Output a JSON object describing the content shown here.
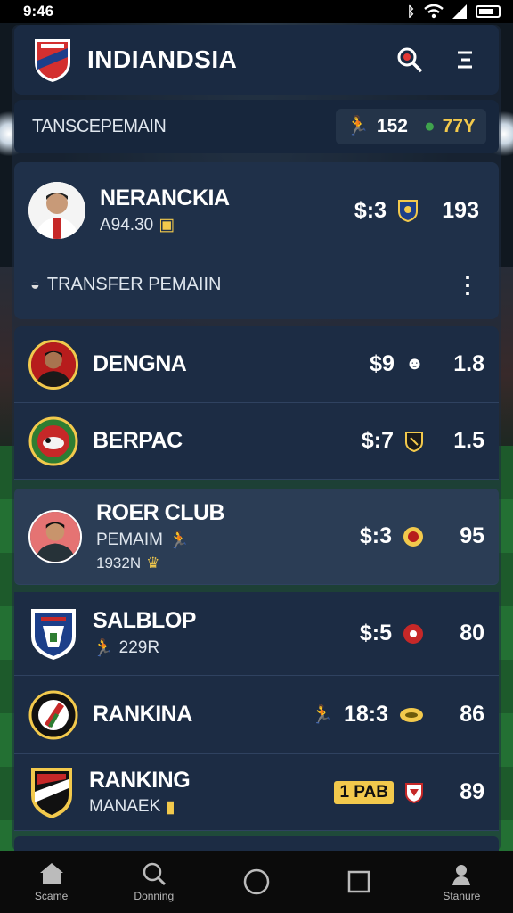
{
  "status_bar": {
    "time": "9:46"
  },
  "header": {
    "title": "INDIANDSIA"
  },
  "subbar": {
    "title": "TANSCEPEMAIN",
    "stat1": "152",
    "stat2": "77Y"
  },
  "featured": {
    "name": "NERANCKIA",
    "sub": "A94.30",
    "price": "$:3",
    "score": "193",
    "section_label": "TRANSFER PEMAIIN"
  },
  "players": [
    {
      "name": "DENGNA",
      "sub1": "",
      "sub2": "",
      "price": "$9",
      "score": "1.8"
    },
    {
      "name": "BERPAC",
      "sub1": "",
      "sub2": "",
      "price": "$:7",
      "score": "1.5"
    },
    {
      "name": "ROER CLUB",
      "sub1": "PEMAIM",
      "sub2": "1932N",
      "price": "$:3",
      "score": "95"
    },
    {
      "name": "SALBLOP",
      "sub1": "229R",
      "sub2": "",
      "price": "$:5",
      "score": "80"
    },
    {
      "name": "RANKINA",
      "sub1": "",
      "sub2": "",
      "price": "18:3",
      "score": "86"
    },
    {
      "name": "RANKING",
      "sub1": "MANAEK",
      "sub2": "",
      "price": "1 PAB",
      "score": "89"
    }
  ],
  "bottom_nav": [
    {
      "label": "Scame",
      "icon": "home-icon"
    },
    {
      "label": "Donning",
      "icon": "search-icon"
    },
    {
      "label": "",
      "icon": "circle-icon"
    },
    {
      "label": "",
      "icon": "square-icon"
    },
    {
      "label": "Stanure",
      "icon": "profile-icon"
    }
  ],
  "colors": {
    "panel": "#1d2d45",
    "accent_yellow": "#f2c94c",
    "accent_red": "#d32f2f",
    "accent_green": "#3fa34d"
  }
}
